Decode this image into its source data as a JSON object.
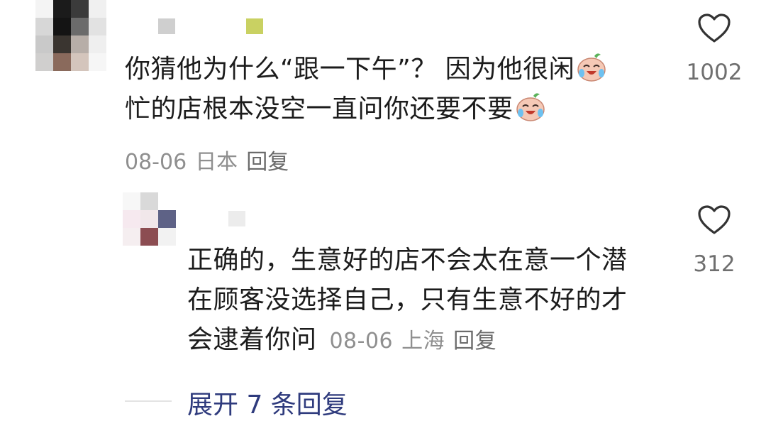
{
  "comments": [
    {
      "text_line1": "你猜他为什么“跟一下午”？ 因为他很闲",
      "text_line2": "忙的店根本没空一直问你还要不要",
      "date": "08-06",
      "location": "日本",
      "reply_label": "回复",
      "likes": "1002",
      "emoji_icon": "crying-laughing-emoji"
    },
    {
      "text_line1": "正确的，生意好的店不会太在意一个潜",
      "text_line2": "在顾客没选择自己，只有生意不好的才",
      "text_line3": "会逮着你问",
      "date": "08-06",
      "location": "上海",
      "reply_label": "回复",
      "likes": "312"
    }
  ],
  "expand_replies_label": "展开 7 条回复",
  "colors": {
    "text": "#1c1c1c",
    "meta": "#8f8f8f",
    "link": "#2f3b7d",
    "name_accent": "#c9d162"
  }
}
